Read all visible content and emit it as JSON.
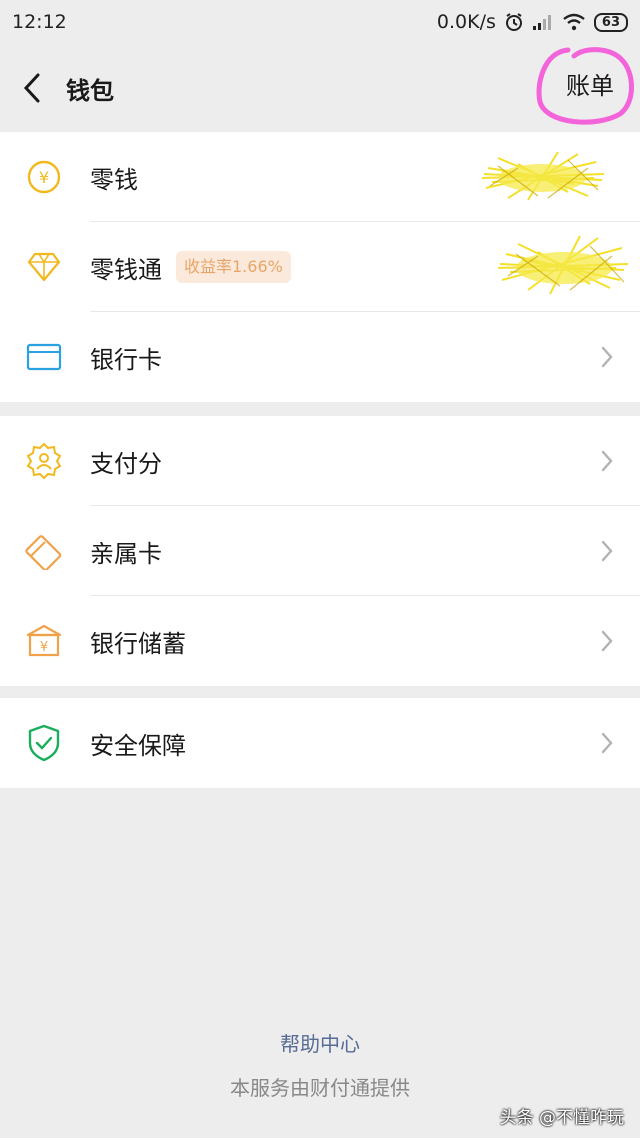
{
  "status": {
    "time": "12:12",
    "net_speed": "0.0K/s",
    "battery": "63"
  },
  "nav": {
    "title": "钱包",
    "bill_label": "账单"
  },
  "groups": [
    {
      "items": [
        {
          "label": "零钱",
          "icon": "yuan-coin-icon"
        },
        {
          "label": "零钱通",
          "icon": "diamond-icon",
          "badge": "收益率1.66%"
        },
        {
          "label": "银行卡",
          "icon": "bank-card-icon"
        }
      ]
    },
    {
      "items": [
        {
          "label": "支付分",
          "icon": "payscore-badge-icon"
        },
        {
          "label": "亲属卡",
          "icon": "family-card-icon"
        },
        {
          "label": "银行储蓄",
          "icon": "bank-building-icon"
        }
      ]
    },
    {
      "items": [
        {
          "label": "安全保障",
          "icon": "shield-check-icon"
        }
      ]
    }
  ],
  "footer": {
    "help": "帮助中心",
    "provider": "本服务由财付通提供"
  },
  "watermark": "头条 @不懂咋玩",
  "colors": {
    "background": "#ededed",
    "accent_yellow": "#f2b91f",
    "accent_orange": "#f0a24a",
    "card_blue": "#2aa1e0",
    "security_green": "#1aad5c",
    "link_blue": "#576b95",
    "annotation_pink": "#f34bd6"
  }
}
